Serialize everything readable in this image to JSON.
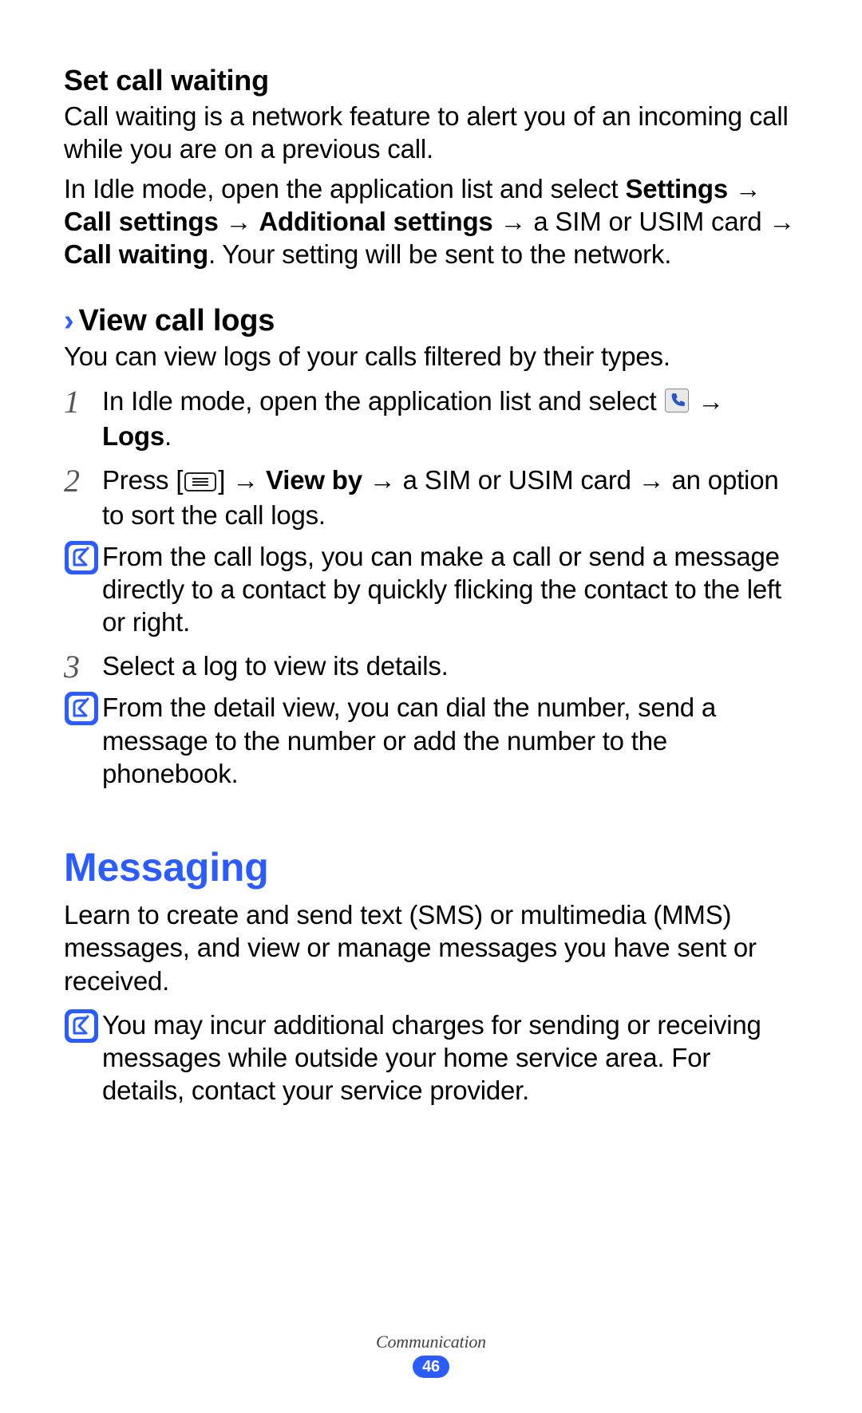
{
  "section1": {
    "heading": "Set call waiting",
    "p1": "Call waiting is a network feature to alert you of an incoming call while you are on a previous call.",
    "p2_a": "In Idle mode, open the application list and select ",
    "p2_b": "Settings",
    "p2_c": " → ",
    "p2_d": "Call settings",
    "p2_e": " → ",
    "p2_f": "Additional settings",
    "p2_g": " → a SIM or USIM card → ",
    "p2_h": "Call waiting",
    "p2_i": ". Your setting will be sent to the network."
  },
  "section2": {
    "chevron": "›",
    "heading": "View call logs",
    "intro": "You can view logs of your calls filtered by their types.",
    "step1": {
      "num": "1",
      "a": "In Idle mode, open the application list and select ",
      "b": " → ",
      "c": "Logs",
      "d": "."
    },
    "step2": {
      "num": "2",
      "a": "Press [",
      "b": "] → ",
      "c": "View by",
      "d": " → a SIM or USIM card → an option to sort the call logs."
    },
    "note1": "From the call logs, you can make a call or send a message directly to a contact by quickly flicking the contact to the left or right.",
    "step3": {
      "num": "3",
      "text": "Select a log to view its details."
    },
    "note2": "From the detail view, you can dial the number, send a message to the number or add the number to the phonebook."
  },
  "section3": {
    "heading": "Messaging",
    "intro": "Learn to create and send text (SMS) or multimedia (MMS) messages, and view or manage messages you have sent or received.",
    "note": "You may incur additional charges for sending or receiving messages while outside your home service area. For details, contact your service provider."
  },
  "footer": {
    "chapter": "Communication",
    "page": "46"
  }
}
